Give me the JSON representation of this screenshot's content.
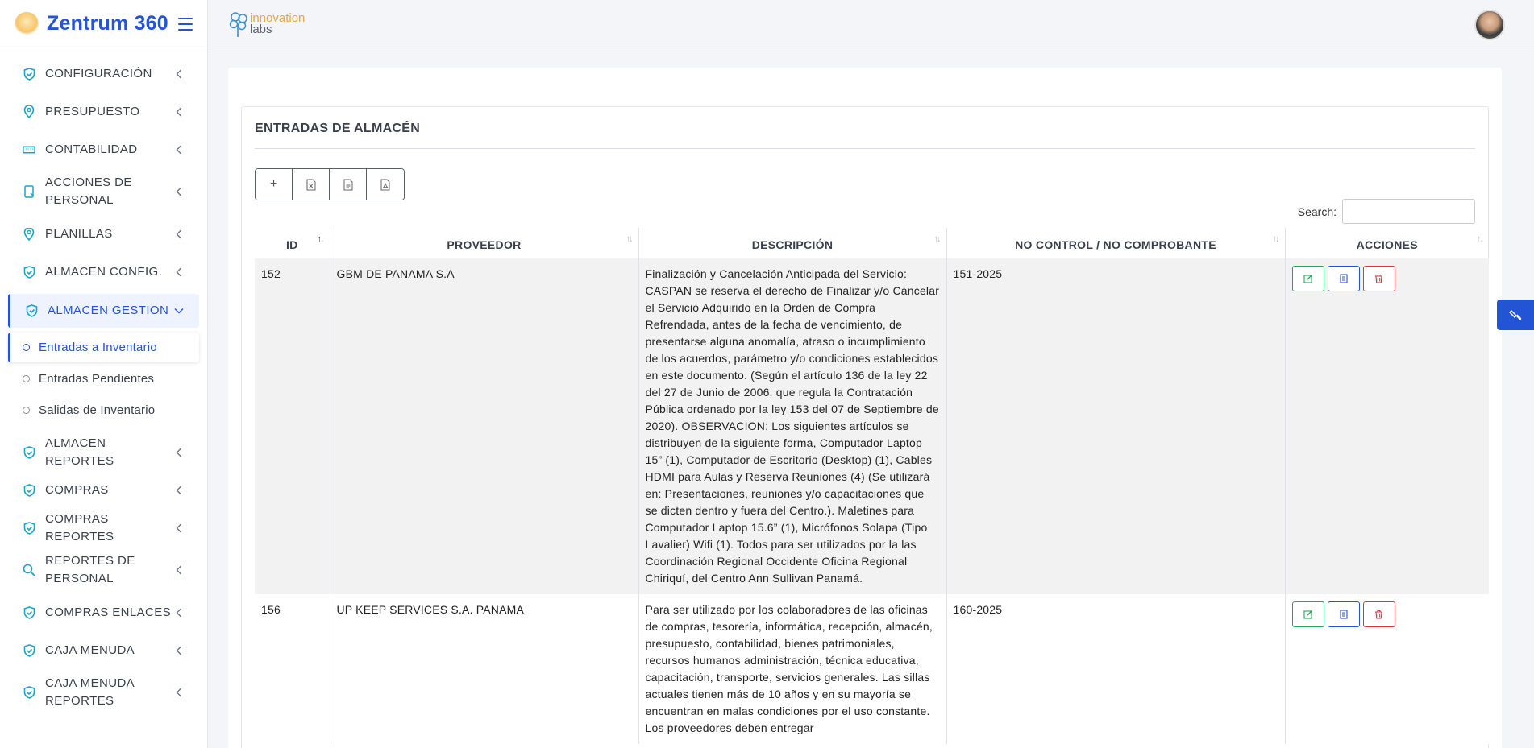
{
  "app": {
    "brand_title": "Zentrum 360",
    "brand_logo_icon": "zentrum-logo",
    "header_logo_text_1": "innovation",
    "header_logo_text_2": "labs",
    "accent_color": "#2454d6"
  },
  "sidebar": {
    "items": [
      {
        "label": "CONFIGURACIÓN",
        "icon": "shield-icon"
      },
      {
        "label": "PRESUPUESTO",
        "icon": "map-pin-icon"
      },
      {
        "label": "CONTABILIDAD",
        "icon": "keyboard-icon"
      },
      {
        "label": "ACCIONES DE PERSONAL",
        "icon": "tablet-icon"
      },
      {
        "label": "PLANILLAS",
        "icon": "map-pin-icon"
      },
      {
        "label": "ALMACEN CONFIG.",
        "icon": "shield-icon"
      },
      {
        "label": "ALMACEN GESTION",
        "icon": "shield-icon"
      },
      {
        "label": "ALMACEN REPORTES",
        "icon": "shield-icon"
      },
      {
        "label": "COMPRAS",
        "icon": "shield-icon"
      },
      {
        "label": "COMPRAS REPORTES",
        "icon": "shield-icon"
      },
      {
        "label": "REPORTES DE PERSONAL",
        "icon": "search-icon"
      },
      {
        "label": "COMPRAS ENLACES",
        "icon": "shield-icon"
      },
      {
        "label": "CAJA MENUDA",
        "icon": "shield-icon"
      },
      {
        "label": "CAJA MENUDA REPORTES",
        "icon": "shield-icon"
      }
    ],
    "submenu": [
      {
        "label": "Entradas a Inventario"
      },
      {
        "label": "Entradas Pendientes"
      },
      {
        "label": "Salidas de Inventario"
      }
    ]
  },
  "page": {
    "title": "ENTRADAS DE ALMACÉN",
    "toolbar": {
      "add_label": "+",
      "excel_icon": "file-excel-icon",
      "csv_icon": "file-text-icon",
      "pdf_icon": "file-pdf-icon"
    },
    "search_label": "Search:",
    "search_value": ""
  },
  "table": {
    "columns": [
      "ID",
      "PROVEEDOR",
      "DESCRIPCIÓN",
      "NO CONTROL / NO COMPROBANTE",
      "ACCIONES"
    ],
    "rows": [
      {
        "id": "152",
        "proveedor": "GBM DE PANAMA S.A",
        "descripcion": "Finalización y Cancelación Anticipada del Servicio: CASPAN se reserva el derecho de Finalizar y/o Cancelar el Servicio Adquirido en la Orden de Compra Refrendada, antes de la fecha de vencimiento, de presentarse alguna anomalía, atraso o incumplimiento de los acuerdos, parámetro y/o condiciones establecidos en este documento. (Según el artículo 136 de la ley 22 del 27 de Junio de 2006, que regula la Contratación Pública ordenado por la ley 153 del 07 de Septiembre de 2020). OBSERVACION: Los siguientes artículos se distribuyen de la siguiente forma, Computador Laptop 15” (1), Computador de Escritorio (Desktop) (1), Cables HDMI para Aulas y Reserva Reuniones (4) (Se utilizará en: Presentaciones, reuniones y/o capacitaciones que se dicten dentro y fuera del Centro.). Maletines para Computador Laptop 15.6” (1), Micrófonos Solapa (Tipo Lavalier) Wifi (1). Todos para ser utilizados por la las Coordinación Regional Occidente Oficina Regional Chiriquí, del Centro Ann Sullivan Panamá.",
        "control": "151-2025"
      },
      {
        "id": "156",
        "proveedor": "UP KEEP SERVICES S.A. PANAMA",
        "descripcion": "Para ser utilizado por los colaboradores de las oficinas de compras, tesorería, informática, recepción, almacén, presupuesto, contabilidad, bienes patrimoniales, recursos humanos administración, técnica educativa, capacitación, transporte, servicios generales. Las sillas actuales tienen más de 10 años y en su mayoría se encuentran en malas condiciones por el uso constante. Los proveedores deben entregar",
        "control": "160-2025"
      }
    ]
  }
}
